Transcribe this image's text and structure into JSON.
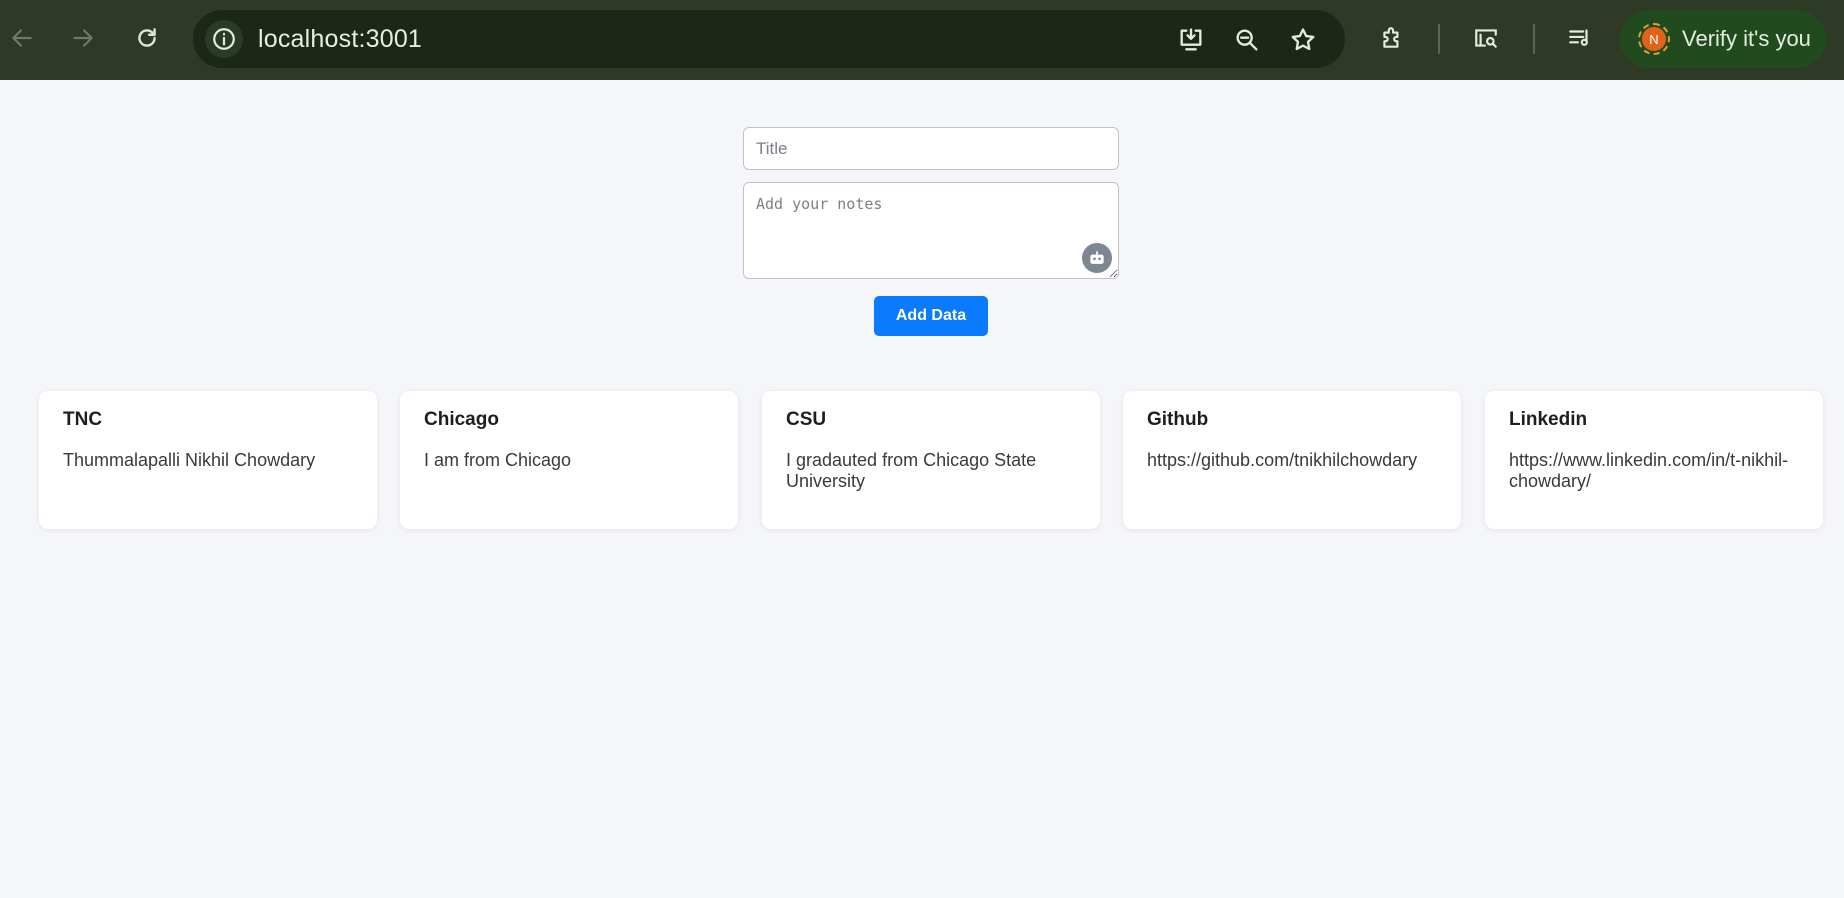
{
  "browser": {
    "url": "localhost:3001",
    "verify_label": "Verify it's you",
    "avatar_initial": "N",
    "icons": {
      "back": "arrow-left-icon",
      "forward": "arrow-right-icon",
      "reload": "reload-icon",
      "site_info": "info-icon",
      "install": "install-app-icon",
      "zoom": "zoom-out-icon",
      "bookmark": "star-icon",
      "extensions": "puzzle-icon",
      "search_tab": "search-tab-icon",
      "media": "media-playlist-icon"
    },
    "colors": {
      "toolbar": "#2e3a26",
      "omnibox": "#1c2717",
      "verify_pill": "#214a1f"
    }
  },
  "form": {
    "title_placeholder": "Title",
    "notes_placeholder": "Add your notes",
    "add_button_label": "Add Data",
    "colors": {
      "button": "#0a7bff"
    }
  },
  "cards": [
    {
      "title": "TNC",
      "body": "Thummalapalli Nikhil Chowdary"
    },
    {
      "title": "Chicago",
      "body": "I am from Chicago"
    },
    {
      "title": "CSU",
      "body": "I gradauted from Chicago State University"
    },
    {
      "title": "Github",
      "body": "https://github.com/tnikhilchowdary"
    },
    {
      "title": "Linkedin",
      "body": "https://www.linkedin.com/in/t-nikhil-chowdary/"
    }
  ]
}
